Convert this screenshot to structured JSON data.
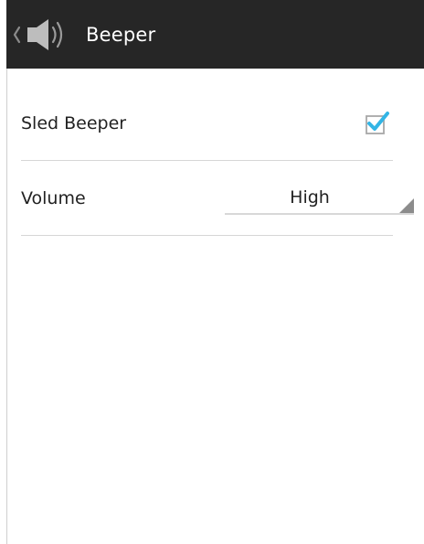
{
  "action_bar": {
    "title": "Beeper",
    "up_icon": "chevron-left-icon",
    "app_icon": "speaker-icon",
    "background_color": "#262626",
    "title_color": "#ffffff"
  },
  "settings": {
    "sled_beeper": {
      "label": "Sled Beeper",
      "checked": true,
      "check_color": "#33b5e5"
    },
    "volume": {
      "label": "Volume",
      "selected": "High",
      "control_icon": "spinner-triangle-icon"
    }
  }
}
